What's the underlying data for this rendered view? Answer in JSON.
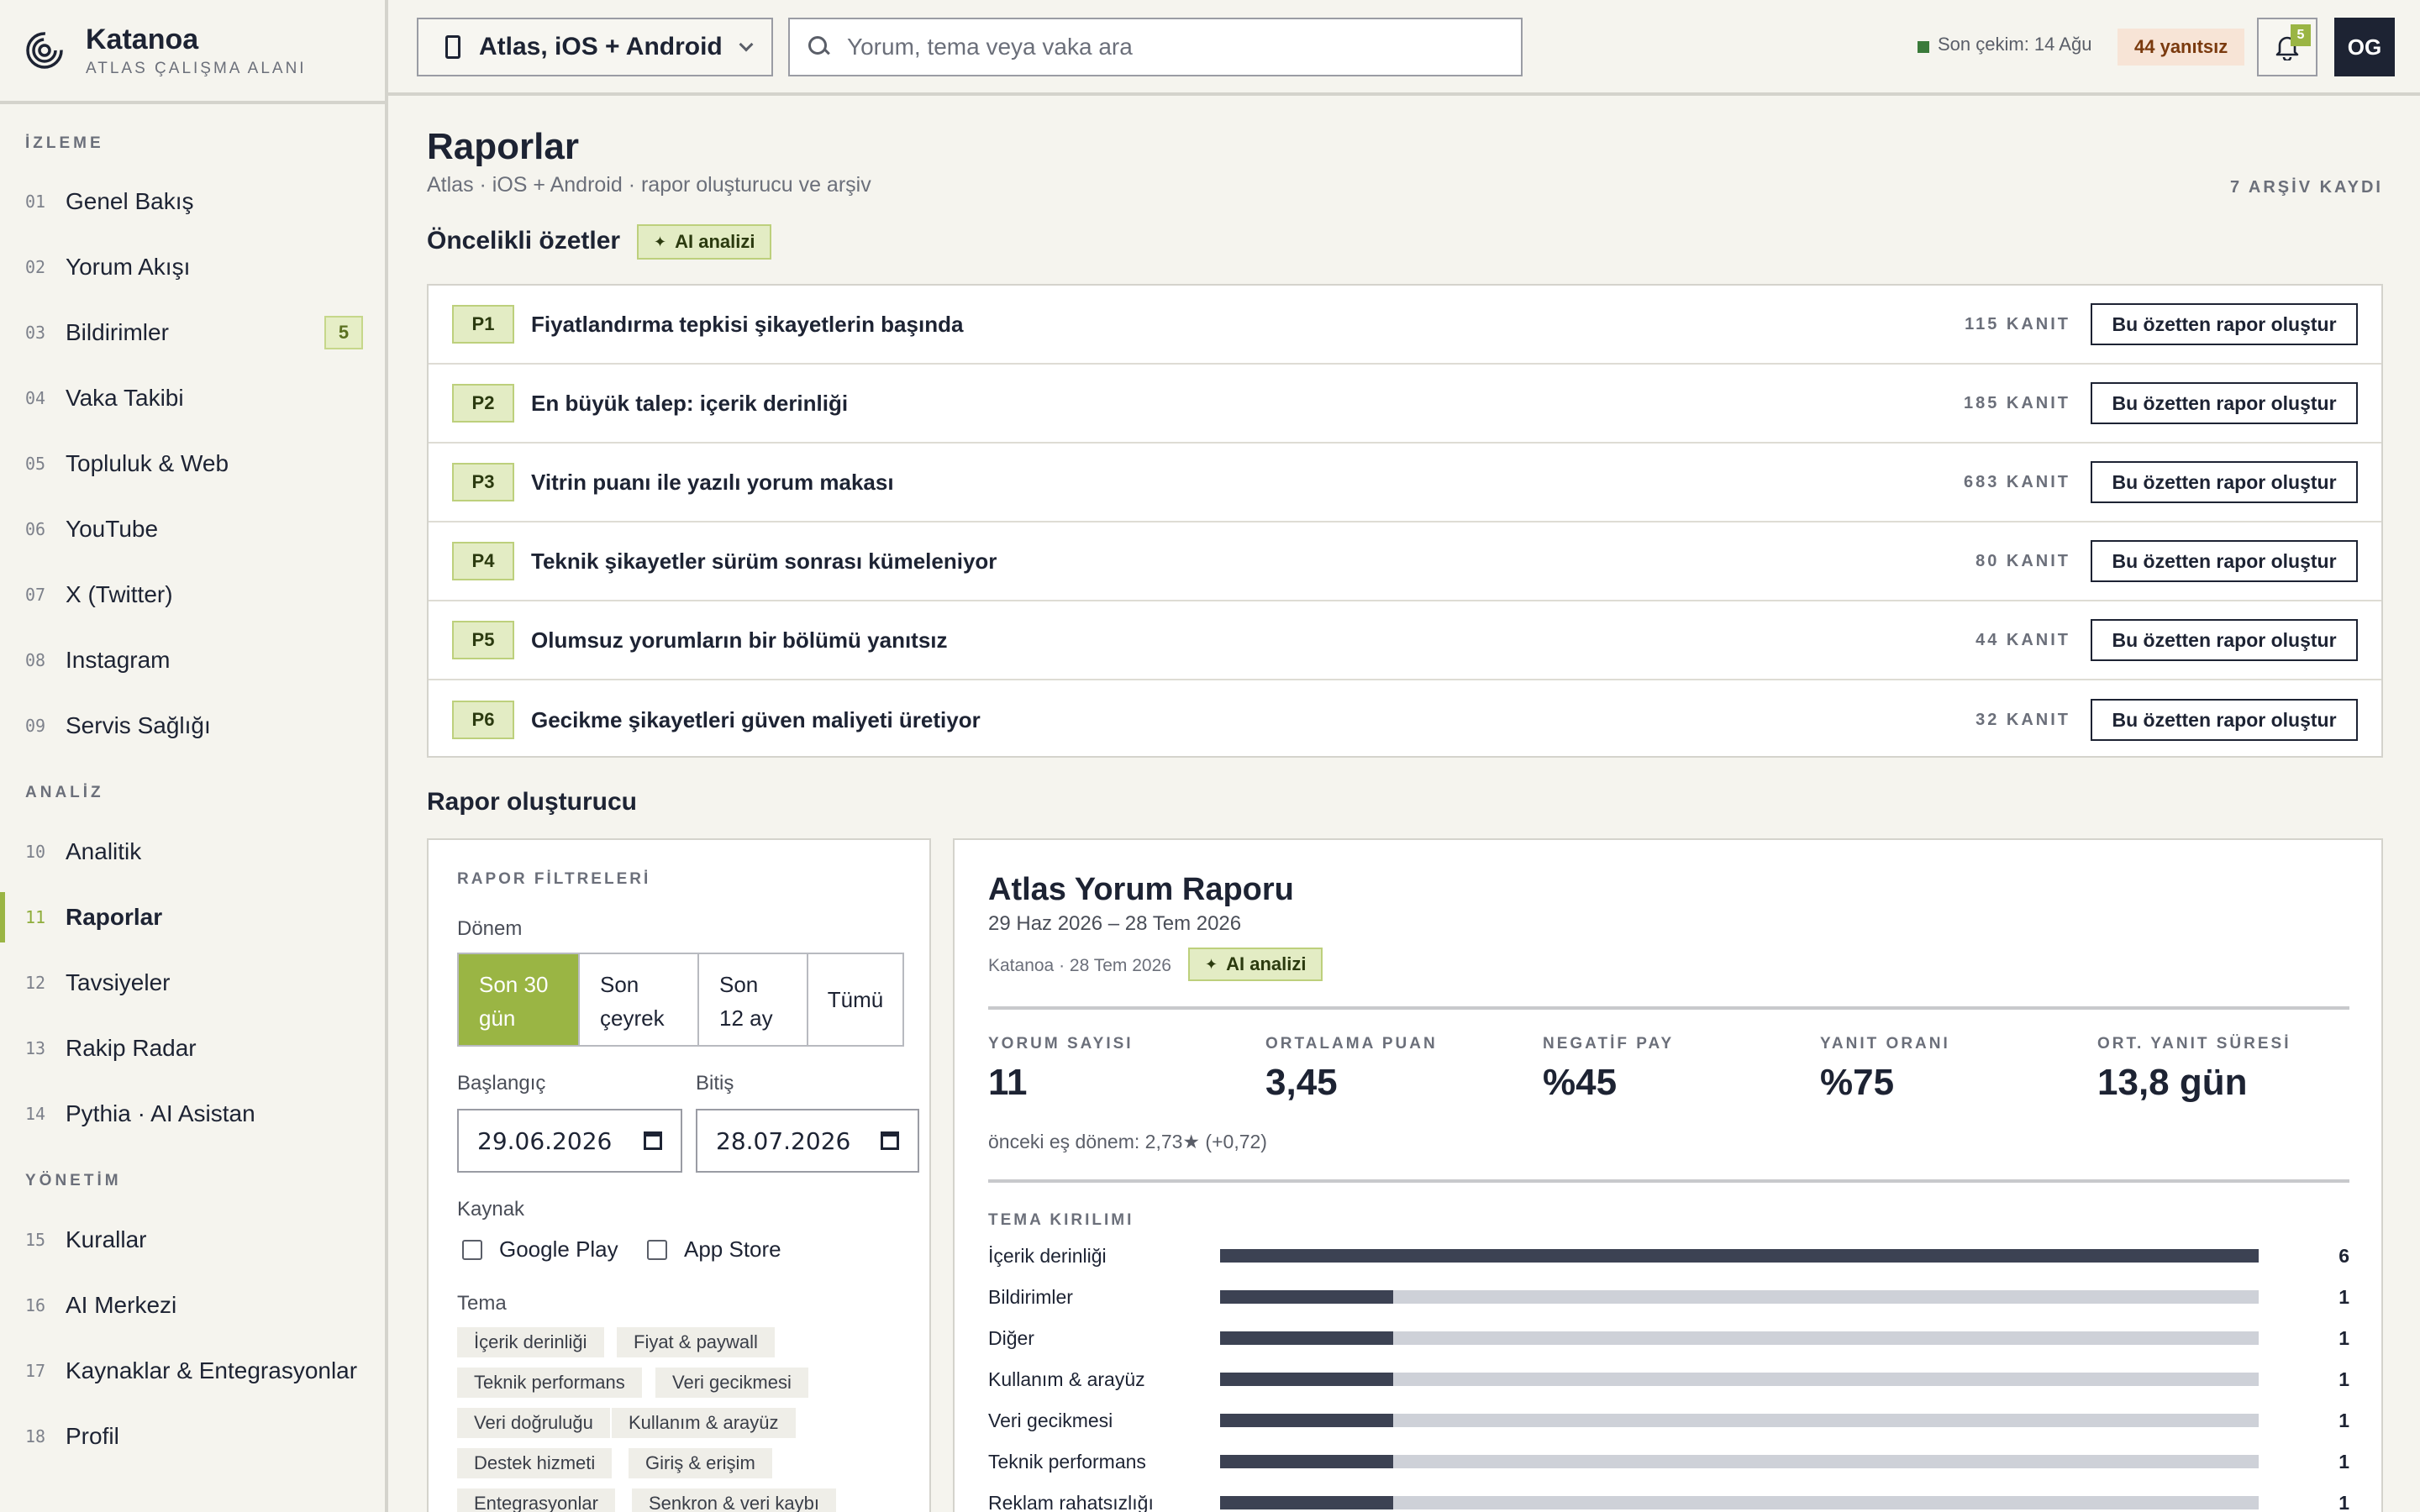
{
  "brand": {
    "name": "Katanoa",
    "subtitle": "ATLAS ÇALIŞMA ALANI"
  },
  "sidebar": {
    "sections": [
      {
        "title": "İZLEME",
        "items": [
          {
            "num": "01",
            "label": "Genel Bakış"
          },
          {
            "num": "02",
            "label": "Yorum Akışı"
          },
          {
            "num": "03",
            "label": "Bildirimler",
            "badge": "5"
          },
          {
            "num": "04",
            "label": "Vaka Takibi"
          },
          {
            "num": "05",
            "label": "Topluluk & Web"
          },
          {
            "num": "06",
            "label": "YouTube"
          },
          {
            "num": "07",
            "label": "X (Twitter)"
          },
          {
            "num": "08",
            "label": "Instagram"
          },
          {
            "num": "09",
            "label": "Servis Sağlığı"
          }
        ]
      },
      {
        "title": "ANALİZ",
        "items": [
          {
            "num": "10",
            "label": "Analitik"
          },
          {
            "num": "11",
            "label": "Raporlar",
            "active": true
          },
          {
            "num": "12",
            "label": "Tavsiyeler"
          },
          {
            "num": "13",
            "label": "Rakip Radar"
          },
          {
            "num": "14",
            "label": "Pythia · AI Asistan"
          }
        ]
      },
      {
        "title": "YÖNETİM",
        "items": [
          {
            "num": "15",
            "label": "Kurallar"
          },
          {
            "num": "16",
            "label": "AI Merkezi"
          },
          {
            "num": "17",
            "label": "Kaynaklar & Entegrasyonlar"
          },
          {
            "num": "18",
            "label": "Profil"
          }
        ]
      }
    ]
  },
  "topbar": {
    "project": "Atlas, iOS + Android",
    "search_placeholder": "Yorum, tema veya vaka ara",
    "last_sync": "Son çekim: 14 Ağu",
    "unanswered": "44 yanıtsız",
    "notification_count": "5",
    "avatar_initials": "OG"
  },
  "page": {
    "title": "Raporlar",
    "subtitle": "Atlas · iOS + Android · rapor oluşturucu ve arşiv",
    "archive_count": "7 ARŞİV KAYDI"
  },
  "priority": {
    "title": "Öncelikli özetler",
    "ai_label": "AI analizi",
    "button_label": "Bu özetten rapor oluştur",
    "items": [
      {
        "tag": "P1",
        "text": "Fiyatlandırma tepkisi şikayetlerin başında",
        "evidence": "115 KANIT"
      },
      {
        "tag": "P2",
        "text": "En büyük talep: içerik derinliği",
        "evidence": "185 KANIT"
      },
      {
        "tag": "P3",
        "text": "Vitrin puanı ile yazılı yorum makası",
        "evidence": "683 KANIT"
      },
      {
        "tag": "P4",
        "text": "Teknik şikayetler sürüm sonrası kümeleniyor",
        "evidence": "80 KANIT"
      },
      {
        "tag": "P5",
        "text": "Olumsuz yorumların bir bölümü yanıtsız",
        "evidence": "44 KANIT"
      },
      {
        "tag": "P6",
        "text": "Gecikme şikayetleri güven maliyeti üretiyor",
        "evidence": "32 KANIT"
      }
    ]
  },
  "builder": {
    "title": "Rapor oluşturucu",
    "filters": {
      "heading": "RAPOR FİLTRELERİ",
      "period_label": "Dönem",
      "periods": [
        {
          "label": "Son 30 gün",
          "active": true
        },
        {
          "label": "Son çeyrek"
        },
        {
          "label": "Son 12 ay"
        },
        {
          "label": "Tümü"
        }
      ],
      "start_label": "Başlangıç",
      "start_value": "29.06.2026",
      "end_label": "Bitiş",
      "end_value": "28.07.2026",
      "source_label": "Kaynak",
      "sources": [
        "Google Play",
        "App Store"
      ],
      "theme_label": "Tema",
      "themes": [
        "İçerik derinliği",
        "Fiyat & paywall",
        "Teknik performans",
        "Veri gecikmesi",
        "Veri doğruluğu",
        "Kullanım & arayüz",
        "Destek hizmeti",
        "Giriş & erişim",
        "Entegrasyonlar",
        "Senkron & veri kaybı"
      ]
    },
    "report": {
      "title": "Atlas Yorum Raporu",
      "range": "29 Haz 2026 – 28 Tem 2026",
      "meta": "Katanoa · 28 Tem 2026",
      "ai_label": "AI analizi",
      "kpis": [
        {
          "label": "YORUM SAYISI",
          "value": "11"
        },
        {
          "label": "ORTALAMA PUAN",
          "value": "3,45"
        },
        {
          "label": "NEGATİF PAY",
          "value": "%45"
        },
        {
          "label": "YANIT ORANI",
          "value": "%75"
        },
        {
          "label": "ORT. YANIT SÜRESİ",
          "value": "13,8 gün"
        }
      ],
      "previous_note": "önceki eş dönem: 2,73★ (+0,72)",
      "theme_heading": "TEMA KIRILIMI",
      "themes_max": 6,
      "themes": [
        {
          "name": "İçerik derinliği",
          "count": 6
        },
        {
          "name": "Bildirimler",
          "count": 1
        },
        {
          "name": "Diğer",
          "count": 1
        },
        {
          "name": "Kullanım & arayüz",
          "count": 1
        },
        {
          "name": "Veri gecikmesi",
          "count": 1
        },
        {
          "name": "Teknik performans",
          "count": 1
        },
        {
          "name": "Reklam rahatsızlığı",
          "count": 1
        }
      ]
    }
  }
}
